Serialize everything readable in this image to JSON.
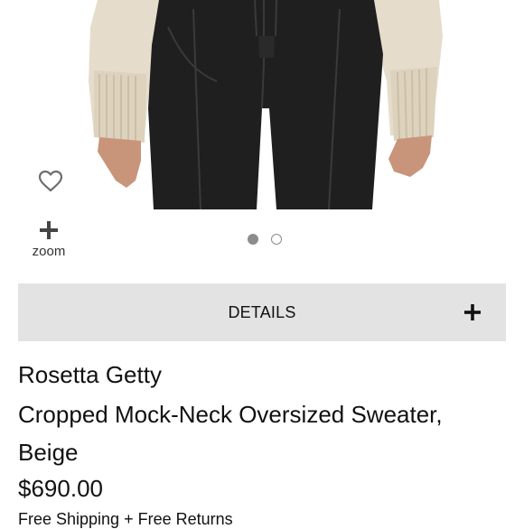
{
  "product_image": {
    "icon": "product-photo"
  },
  "wishlist": {
    "icon": "heart-icon"
  },
  "zoom": {
    "icon": "plus-icon",
    "label": "zoom"
  },
  "carousel": {
    "current": 1,
    "total": 2
  },
  "details": {
    "label": "DETAILS",
    "icon": "plus-icon"
  },
  "product": {
    "brand": "Rosetta Getty",
    "name": "Cropped Mock-Neck Oversized Sweater, Beige",
    "price": "$690.00",
    "shipping": "Free Shipping + Free Returns"
  },
  "colors": {
    "details_bar_bg": "#e3e3e3",
    "text": "#111111",
    "sweater": "#e6dccb",
    "pants": "#1f1f1f"
  }
}
